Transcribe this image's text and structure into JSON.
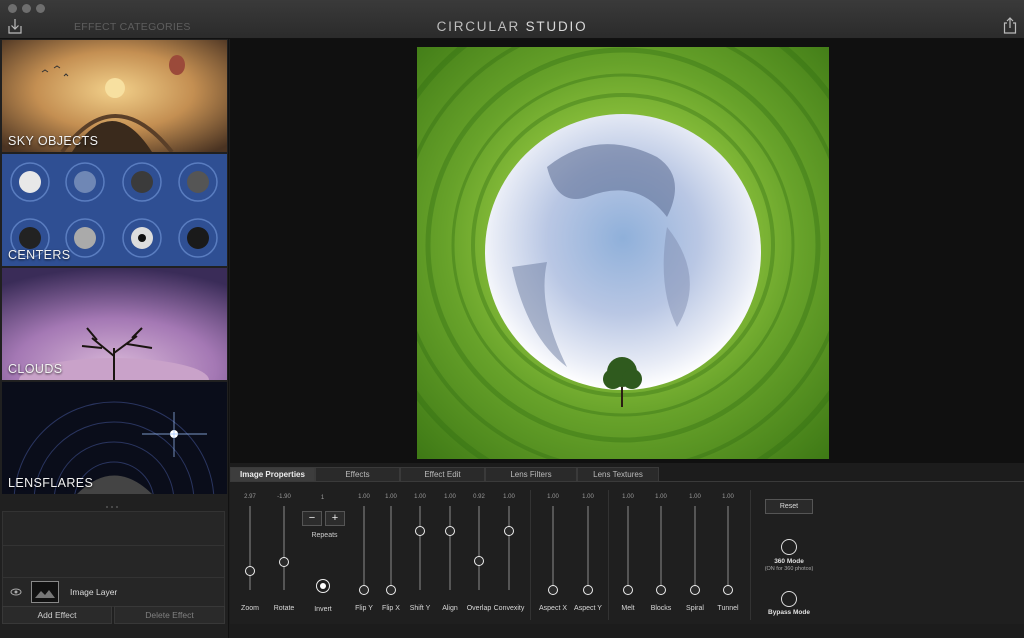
{
  "titlebar": {
    "categories_label": "EFFECT CATEGORIES",
    "title_main": "CIRCULAR",
    "title_second": "STUDIO"
  },
  "categories": [
    {
      "label": "SKY OBJECTS"
    },
    {
      "label": "CENTERS"
    },
    {
      "label": "CLOUDS"
    },
    {
      "label": "LENSFLARES"
    }
  ],
  "layers": {
    "layer_label": "Image Layer",
    "add_label": "Add Effect",
    "delete_label": "Delete Effect"
  },
  "tabs": [
    {
      "label": "Image Properties",
      "active": true
    },
    {
      "label": "Effects"
    },
    {
      "label": "Effect Edit"
    },
    {
      "label": "Lens Filters"
    },
    {
      "label": "Lens Textures"
    }
  ],
  "sliders": [
    {
      "label": "Zoom",
      "value": "2.97",
      "level": 0.23
    },
    {
      "label": "Rotate",
      "value": "-1.90",
      "level": 0.33
    },
    {
      "label": "Flip Y",
      "value": "1.00",
      "level": 0.0
    },
    {
      "label": "Flip X",
      "value": "1.00",
      "level": 0.0
    },
    {
      "label": "Shift Y",
      "value": "1.00",
      "level": 0.7
    },
    {
      "label": "Align",
      "value": "1.00",
      "level": 0.7
    },
    {
      "label": "Overlap",
      "value": "0.92",
      "level": 0.34
    },
    {
      "label": "Convexity",
      "value": "1.00",
      "level": 0.7
    },
    {
      "label": "Aspect X",
      "value": "1.00",
      "level": 0.0
    },
    {
      "label": "Aspect Y",
      "value": "1.00",
      "level": 0.0
    },
    {
      "label": "Melt",
      "value": "1.00",
      "level": 0.0
    },
    {
      "label": "Blocks",
      "value": "1.00",
      "level": 0.0
    },
    {
      "label": "Spiral",
      "value": "1.00",
      "level": 0.0
    },
    {
      "label": "Tunnel",
      "value": "1.00",
      "level": 0.0
    }
  ],
  "repeats": {
    "value": "1",
    "label": "Repeats",
    "minus": "−",
    "plus": "+"
  },
  "invert": {
    "label": "Invert",
    "on": true
  },
  "reset_label": "Reset",
  "mode360": {
    "label": "360 Mode",
    "sub": "(ON for 360 photos)"
  },
  "bypass": {
    "label": "Bypass Mode"
  }
}
